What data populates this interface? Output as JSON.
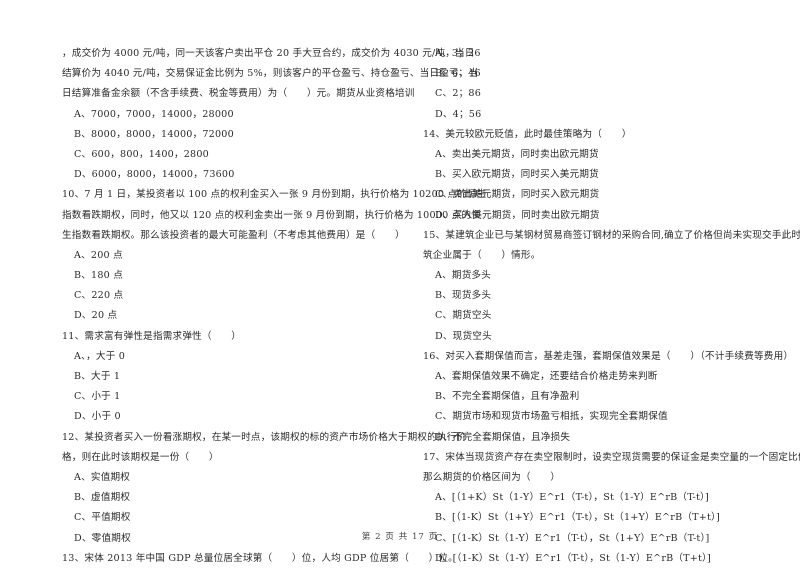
{
  "left_column": {
    "q9_stem": [
      "，成交价为 4000 元/吨，同一天该客户卖出平仓 20 手大豆合约，成交价为 4030 元/吨，当日",
      "结算价为 4040 元/吨，交易保证金比例为 5%，则该客户的平仓盈亏、持仓盈亏、当日盈亏、当",
      "日结算准备金余额（不含手续费、税金等费用）为（　　）元。期货从业资格培训"
    ],
    "q9_options": [
      "A、7000，7000，14000，28000",
      "B、8000，8000，14000，72000",
      "C、600，800，1400，2800",
      "D、6000，8000，14000，73600"
    ],
    "q10_stem": [
      "10、7 月 1 日，某投资者以 100 点的权利金买入一张 9 月份到期，执行价格为 10200 点的恒生",
      "指数看跌期权，同时，他又以 120 点的权利金卖出一张 9 月份到期，执行价格为 10000 点的恒",
      "生指数看跌期权。那么该投资者的最大可能盈利（不考虑其他费用）是（　　）"
    ],
    "q10_options": [
      "A、200 点",
      "B、180 点",
      "C、220 点",
      "D、20 点"
    ],
    "q11_stem": [
      "11、需求富有弹性是指需求弹性（　　）"
    ],
    "q11_options": [
      "A、，大于 0",
      "B、大于 1",
      "C、小于 1",
      "D、小于 0"
    ],
    "q12_stem": [
      "12、某投资者买入一份看涨期权，在某一时点，该期权的标的资产市场价格大于期权的执行价",
      "格，则在此时该期权是一份（　　）"
    ],
    "q12_options": [
      "A、实值期权",
      "B、虚值期权",
      "C、平值期权",
      "D、零值期权"
    ],
    "q13_stem": [
      "13、宋体 2013 年中国 GDP 总量位居全球第（　　）位，人均 GDP 位居第（　　）位。"
    ]
  },
  "right_column": {
    "q13_options": [
      "A、3；26",
      "B、6；46",
      "C、2；86",
      "D、4；56"
    ],
    "q14_stem": [
      "14、美元较欧元贬值，此时最佳策略为（　　）"
    ],
    "q14_options": [
      "A、卖出美元期货，同时卖出欧元期货",
      "B、买入欧元期货，同时买入美元期货",
      "C、卖出美元期货，同时买入欧元期货",
      "D、买入美元期货，同时卖出欧元期货"
    ],
    "q15_stem": [
      "15、某建筑企业已与某钢材贸易商签订钢材的采购合同,确立了价格但尚未实现交手此时该建",
      "筑企业属于（　　）情形。"
    ],
    "q15_options": [
      "A、期货多头",
      "B、现货多头",
      "C、期货空头",
      "D、现货空头"
    ],
    "q16_stem": [
      "16、对买入套期保值而言，基差走强，套期保值效果是（　　）（不计手续费等费用）"
    ],
    "q16_options": [
      "A、套期保值效果不确定，还要结合价格走势来判断",
      "B、不完全套期保值，且有净盈利",
      "C、期货市场和现货市场盈亏相抵，实现完全套期保值",
      "D、不完全套期保值，且净损失"
    ],
    "q17_stem": [
      "17、宋体当现货资产存在卖空限制时，设卖空现货需要的保证金是卖空量的一个固定比例 K，",
      "那么期货的价格区间为（　　）"
    ],
    "q17_options": [
      "A、[（1+K）St（1-Y）E^r1（T-t），St（1-Y）E^rB（T-t）]",
      "B、[（1-K）St（1+Y）E^r1（T-t），St（1+Y）E^rB（T+t）]",
      "C、[（1-K）St（1-Y）E^r1（T-t），St（1+Y）E^rB（T-t）]",
      "D、[（1-K）St（1-Y）E^r1（T-t），St（1-Y）E^rB（T+t）]"
    ]
  },
  "footer": {
    "page_label": "第 2 页 共 17 页"
  }
}
